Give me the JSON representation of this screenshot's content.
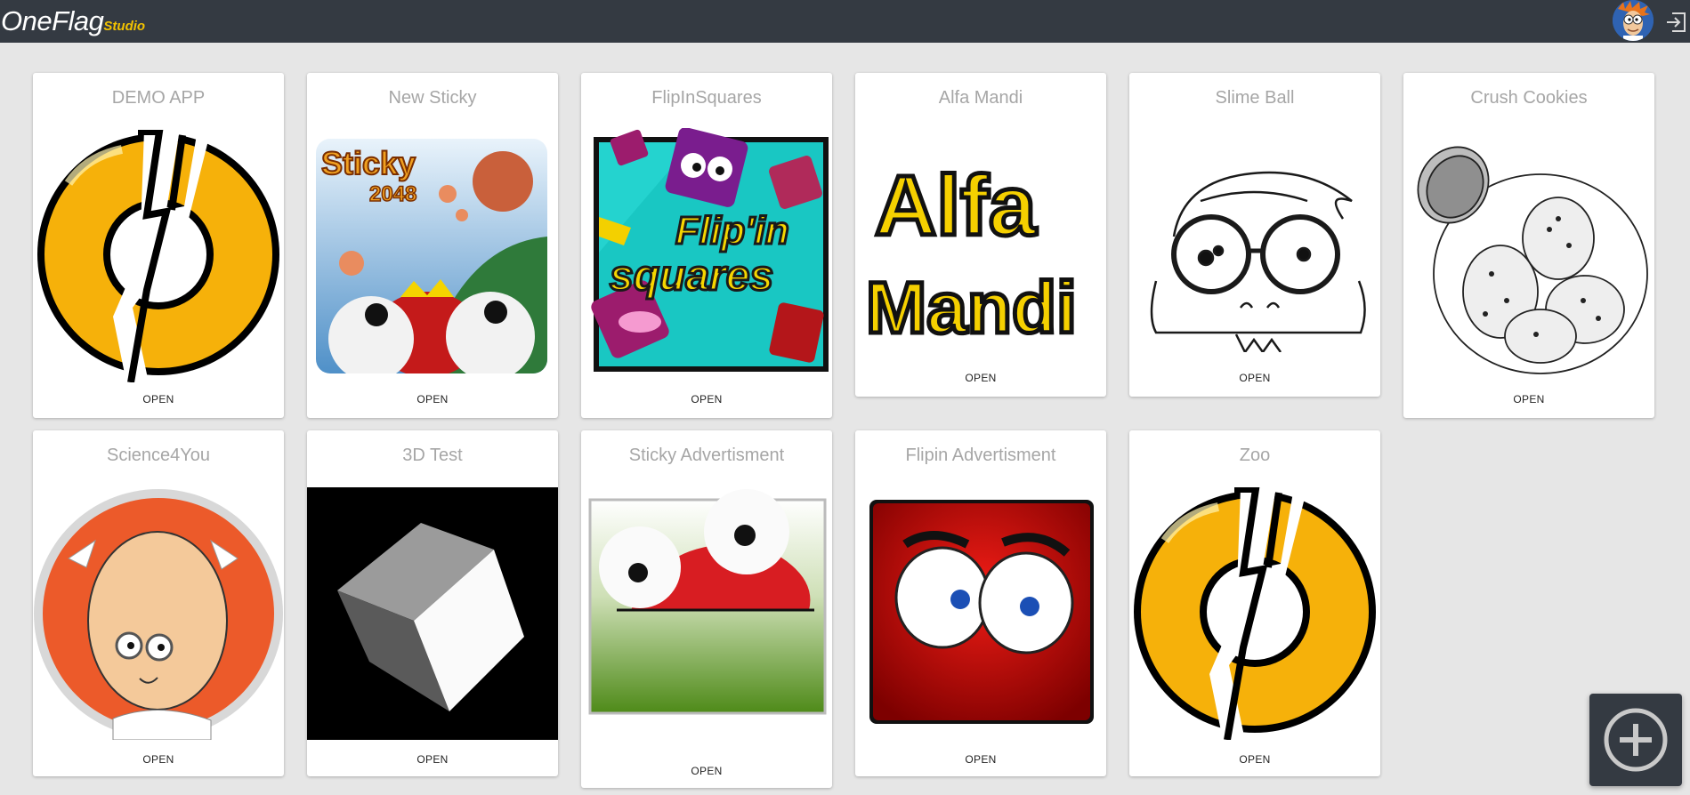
{
  "header": {
    "brand_main": "OneFlag",
    "brand_sub": "Studio",
    "avatar_icon": "user-avatar-icon",
    "logout_icon": "logout-icon"
  },
  "projects": [
    {
      "title": "DEMO APP",
      "action": "OPEN",
      "art": "oneflag-logo-icon"
    },
    {
      "title": "New Sticky",
      "action": "OPEN",
      "art": "sticky-2048-art",
      "art_text_1": "Sticky",
      "art_text_2": "2048"
    },
    {
      "title": "FlipInSquares",
      "action": "OPEN",
      "art": "flipin-squares-art",
      "art_text_1": "Flip'in",
      "art_text_2": "squares"
    },
    {
      "title": "Alfa Mandi",
      "action": "OPEN",
      "art": "alfa-mandi-art",
      "art_text_1": "Alfa",
      "art_text_2": "Mandi"
    },
    {
      "title": "Slime Ball",
      "action": "OPEN",
      "art": "slime-ball-sketch"
    },
    {
      "title": "Crush Cookies",
      "action": "OPEN",
      "art": "cookie-jar-sketch"
    },
    {
      "title": "Science4You",
      "action": "OPEN",
      "art": "scientist-avatar"
    },
    {
      "title": "3D Test",
      "action": "OPEN",
      "art": "3d-cube-render"
    },
    {
      "title": "Sticky Advertisment",
      "action": "OPEN",
      "art": "sticky-ad-art"
    },
    {
      "title": "Flipin Advertisment",
      "action": "OPEN",
      "art": "flipin-ad-art"
    },
    {
      "title": "Zoo",
      "action": "OPEN",
      "art": "oneflag-logo-icon"
    }
  ],
  "fab": {
    "icon": "add-circle-icon"
  },
  "colors": {
    "topbar": "#343a42",
    "background": "#e6e6e6",
    "brand_accent": "#f2c200",
    "card_title": "#a6a6a6"
  }
}
